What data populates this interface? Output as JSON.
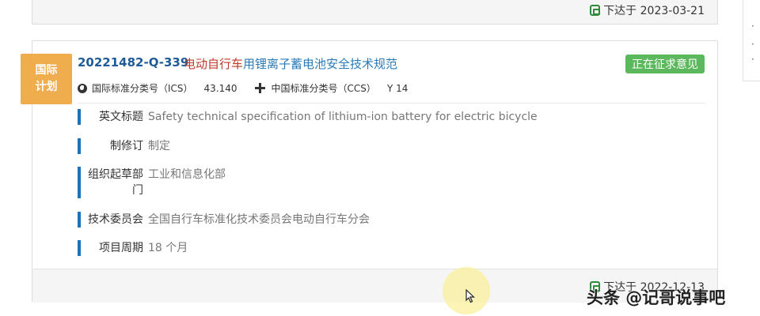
{
  "previous_card": {
    "footer_date": "下达于 2023-03-21"
  },
  "side_panel": {
    "bullets": [
      "·",
      "·",
      "·"
    ]
  },
  "card": {
    "badge": "国际\n计划",
    "code": "20221482-Q-339",
    "title_highlight": "电动自行车",
    "title_rest": "用锂离子蓄电池安全技术规范",
    "status": "正在征求意见",
    "ics_label": "国际标准分类号（ICS）",
    "ics_value": "43.140",
    "ccs_label": "中国标准分类号（CCS）",
    "ccs_value": "Y 14",
    "fields": [
      {
        "label": "英文标题",
        "value": "Safety technical specification of lithium-ion battery for electric bicycle"
      },
      {
        "label": "制修订",
        "value": "制定"
      },
      {
        "label": "组织起草部门",
        "value": "工业和信息化部"
      },
      {
        "label": "技术委员会",
        "value": "全国自行车标准化技术委员会电动自行车分会"
      },
      {
        "label": "项目周期",
        "value": "18 个月"
      }
    ],
    "footer_date": "下达于 2022-12-13"
  },
  "watermark": "头条 @记哥说事吧",
  "colors": {
    "badge": "#f0ad4e",
    "status": "#5cb85c",
    "code": "#1e5b98",
    "title_highlight": "#c0392b",
    "title_link": "#2a7ab8",
    "field_bar": "#1e73b5"
  }
}
